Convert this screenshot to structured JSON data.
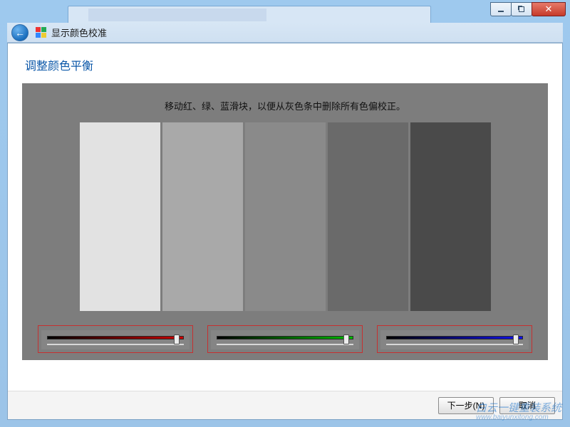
{
  "header": {
    "back_tooltip": "返回",
    "app_title": "显示颜色校准"
  },
  "page": {
    "title": "调整颜色平衡",
    "instruction": "移动红、绿、蓝滑块，以便从灰色条中删除所有色偏校正。"
  },
  "gray_bars": [
    "#e2e2e2",
    "#a9a9a9",
    "#8a8a8a",
    "#6a6a6a",
    "#4a4a4a"
  ],
  "sliders": {
    "red": {
      "name": "red",
      "value": 96,
      "min": 0,
      "max": 100
    },
    "green": {
      "name": "green",
      "value": 96,
      "min": 0,
      "max": 100
    },
    "blue": {
      "name": "blue",
      "value": 96,
      "min": 0,
      "max": 100
    }
  },
  "footer": {
    "next_label": "下一步(N)",
    "cancel_label": "取消"
  },
  "watermark": {
    "line1": "白云一键重装系统",
    "line2": "www.baiyunxitong.com"
  },
  "window_controls": {
    "minimize": "minimize",
    "maximize": "maximize",
    "close": "close"
  }
}
